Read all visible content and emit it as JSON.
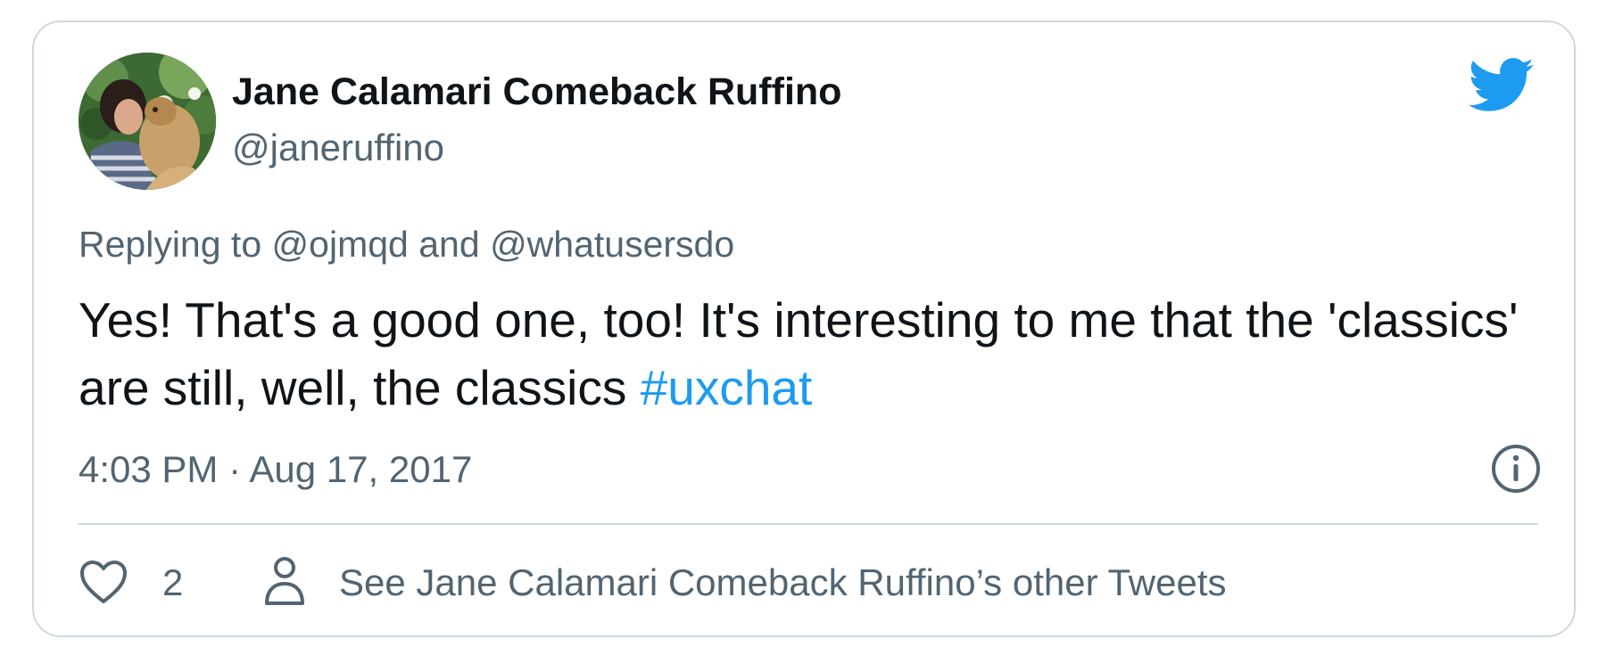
{
  "tweet": {
    "author": {
      "display_name": "Jane Calamari Comeback Ruffino",
      "handle": "@janeruffino"
    },
    "reply_context": {
      "prefix": "Replying to",
      "mention_1": "@ojmqd",
      "conjunction": "and",
      "mention_2": "@whatusersdo"
    },
    "text": {
      "body": "Yes! That's a good one, too! It's interesting to me that the 'classics' are still, well, the classics",
      "hashtag": "#uxchat"
    },
    "timestamp": "4:03 PM · Aug 17, 2017",
    "actions": {
      "like_count": "2",
      "other_tweets_label": "See Jane Calamari Comeback Ruffino’s other Tweets"
    }
  },
  "icons": {
    "brand": "twitter-bird-icon",
    "info": "info-icon",
    "like": "heart-icon",
    "profile": "person-icon"
  },
  "colors": {
    "brand_blue": "#1d9bf0",
    "text_primary": "#0f1419",
    "text_secondary": "#536471",
    "border": "#cfd9de"
  }
}
